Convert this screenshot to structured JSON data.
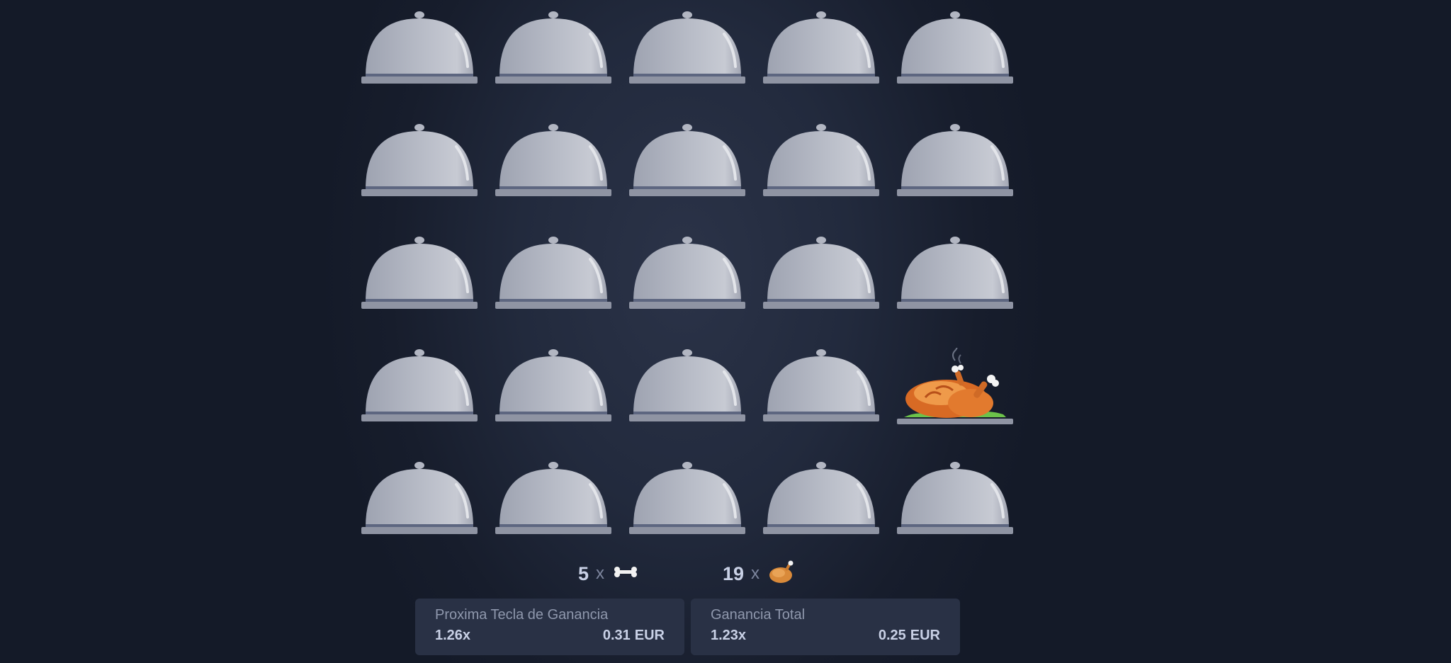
{
  "board": {
    "rows": 5,
    "cols": 5,
    "tiles": [
      "covered",
      "covered",
      "covered",
      "covered",
      "covered",
      "covered",
      "covered",
      "covered",
      "covered",
      "covered",
      "covered",
      "covered",
      "covered",
      "covered",
      "covered",
      "covered",
      "covered",
      "covered",
      "covered",
      "chicken",
      "covered",
      "covered",
      "covered",
      "covered",
      "covered"
    ]
  },
  "counters": {
    "bones": {
      "count": "5",
      "times": "x",
      "icon": "bone-icon"
    },
    "chickens": {
      "count": "19",
      "times": "x",
      "icon": "chicken-icon"
    }
  },
  "next_win": {
    "title": "Proxima Tecla de Ganancia",
    "multiplier": "1.26x",
    "amount": "0.31",
    "currency": "EUR"
  },
  "total_win": {
    "title": "Ganancia Total",
    "multiplier": "1.23x",
    "amount": "0.25",
    "currency": "EUR"
  },
  "colors": {
    "background": "#151b2a",
    "panel": "#293145",
    "cloche": "#b4b8c4",
    "text": "#c9d1e6",
    "muted": "#8f98ad"
  }
}
